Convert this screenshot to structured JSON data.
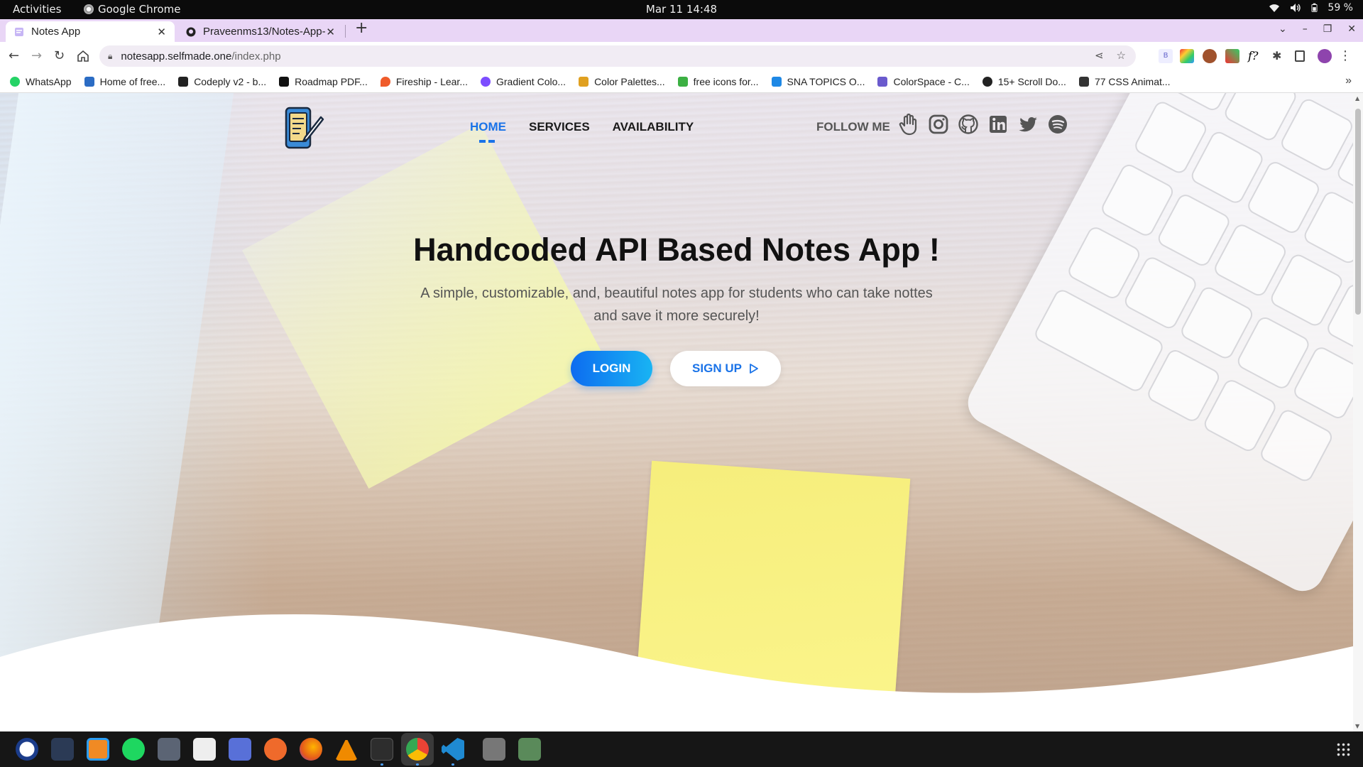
{
  "os_bar": {
    "activities": "Activities",
    "app_name": "Google Chrome",
    "clock": "Mar 11  14:48",
    "battery": "59 %"
  },
  "browser": {
    "tabs": [
      {
        "title": "Notes App",
        "active": true
      },
      {
        "title": "Praveenms13/Notes-App-",
        "active": false
      }
    ],
    "url_host": "notesapp.selfmade.one",
    "url_path": "/index.php",
    "bookmarks": [
      {
        "label": "WhatsApp",
        "color": "#25d366"
      },
      {
        "label": "Home of free...",
        "color": "#2b6cc4"
      },
      {
        "label": "Codeply v2 - b...",
        "color": "#222222"
      },
      {
        "label": "Roadmap PDF...",
        "color": "#111111"
      },
      {
        "label": "Fireship - Lear...",
        "color": "#ef5b2a"
      },
      {
        "label": "Gradient Colo...",
        "color": "#7c4dff"
      },
      {
        "label": "Color Palettes...",
        "color": "#e0a020"
      },
      {
        "label": "free icons for...",
        "color": "#3cb043"
      },
      {
        "label": "SNA TOPICS O...",
        "color": "#1e88e5"
      },
      {
        "label": "ColorSpace - C...",
        "color": "#6a5acd"
      },
      {
        "label": "15+ Scroll Do...",
        "color": "#222222"
      },
      {
        "label": "77 CSS Animat...",
        "color": "#333333"
      }
    ]
  },
  "page": {
    "nav": {
      "home": "HOME",
      "services": "SERVICES",
      "availability": "AVAILABILITY",
      "follow": "FOLLOW ME"
    },
    "social_icons": [
      "hand-icon",
      "instagram-icon",
      "github-icon",
      "linkedin-icon",
      "twitter-icon",
      "spotify-icon"
    ],
    "hero": {
      "title": "Handcoded API Based Notes App !",
      "subtitle": "A simple, customizable, and, beautiful notes app for students who can take nottes and save it more securely!",
      "login": "LOGIN",
      "signup": "SIGN UP"
    },
    "colors": {
      "accent": "#1a73e8",
      "login_gradient_start": "#0d6cf0",
      "login_gradient_end": "#19b4f3",
      "tabstrip": "#e9d6f6"
    }
  }
}
